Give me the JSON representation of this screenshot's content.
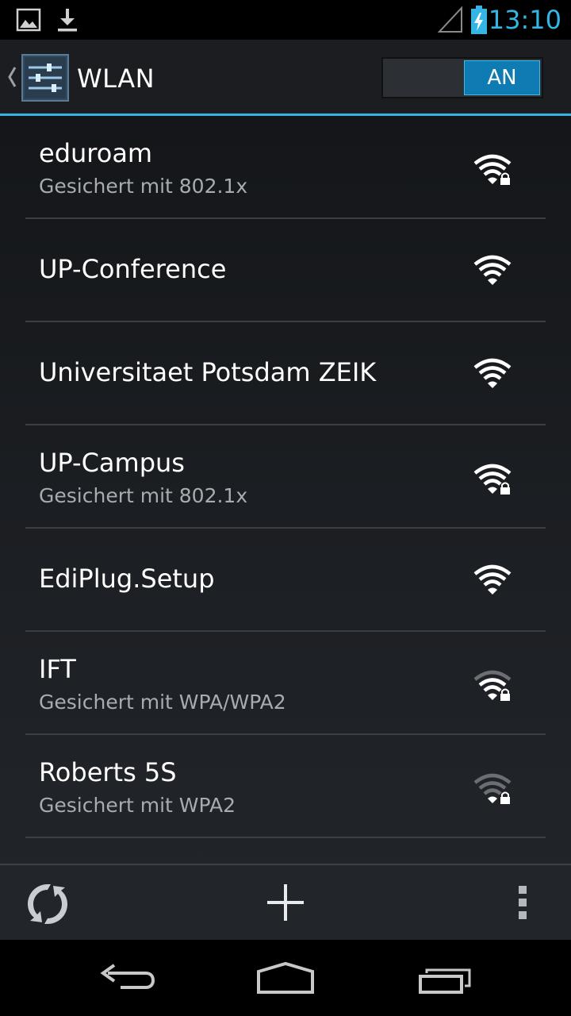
{
  "status_bar": {
    "time": "13:10",
    "icons": [
      "image-notification-icon",
      "download-notification-icon",
      "cell-signal-icon",
      "battery-charging-icon"
    ]
  },
  "action_bar": {
    "title": "WLAN",
    "toggle_label": "AN",
    "toggle_on": true,
    "icons": [
      "up-caret-icon",
      "settings-app-icon"
    ]
  },
  "networks": [
    {
      "ssid": "eduroam",
      "security": "Gesichert mit 802.1x",
      "locked": true,
      "signal_level": 4
    },
    {
      "ssid": "UP-Conference",
      "security": "",
      "locked": false,
      "signal_level": 4
    },
    {
      "ssid": "Universitaet Potsdam ZEIK",
      "security": "",
      "locked": false,
      "signal_level": 4
    },
    {
      "ssid": "UP-Campus",
      "security": "Gesichert mit 802.1x",
      "locked": true,
      "signal_level": 4
    },
    {
      "ssid": "EdiPlug.Setup",
      "security": "",
      "locked": false,
      "signal_level": 4
    },
    {
      "ssid": "IFT",
      "security": "Gesichert mit WPA/WPA2",
      "locked": true,
      "signal_level": 3
    },
    {
      "ssid": "Roberts 5S",
      "security": "Gesichert mit WPA2",
      "locked": true,
      "signal_level": 1
    }
  ],
  "toolbar": {
    "icons": [
      "wps-icon",
      "add-network-icon",
      "overflow-menu-icon"
    ]
  },
  "nav_bar": {
    "icons": [
      "back-icon",
      "home-icon",
      "recent-apps-icon"
    ]
  },
  "colors": {
    "accent": "#33b5e5",
    "text_primary": "#ffffff",
    "text_secondary": "#a8acb0",
    "signal_active": "#ffffff",
    "signal_dim": "#6b6f73"
  }
}
